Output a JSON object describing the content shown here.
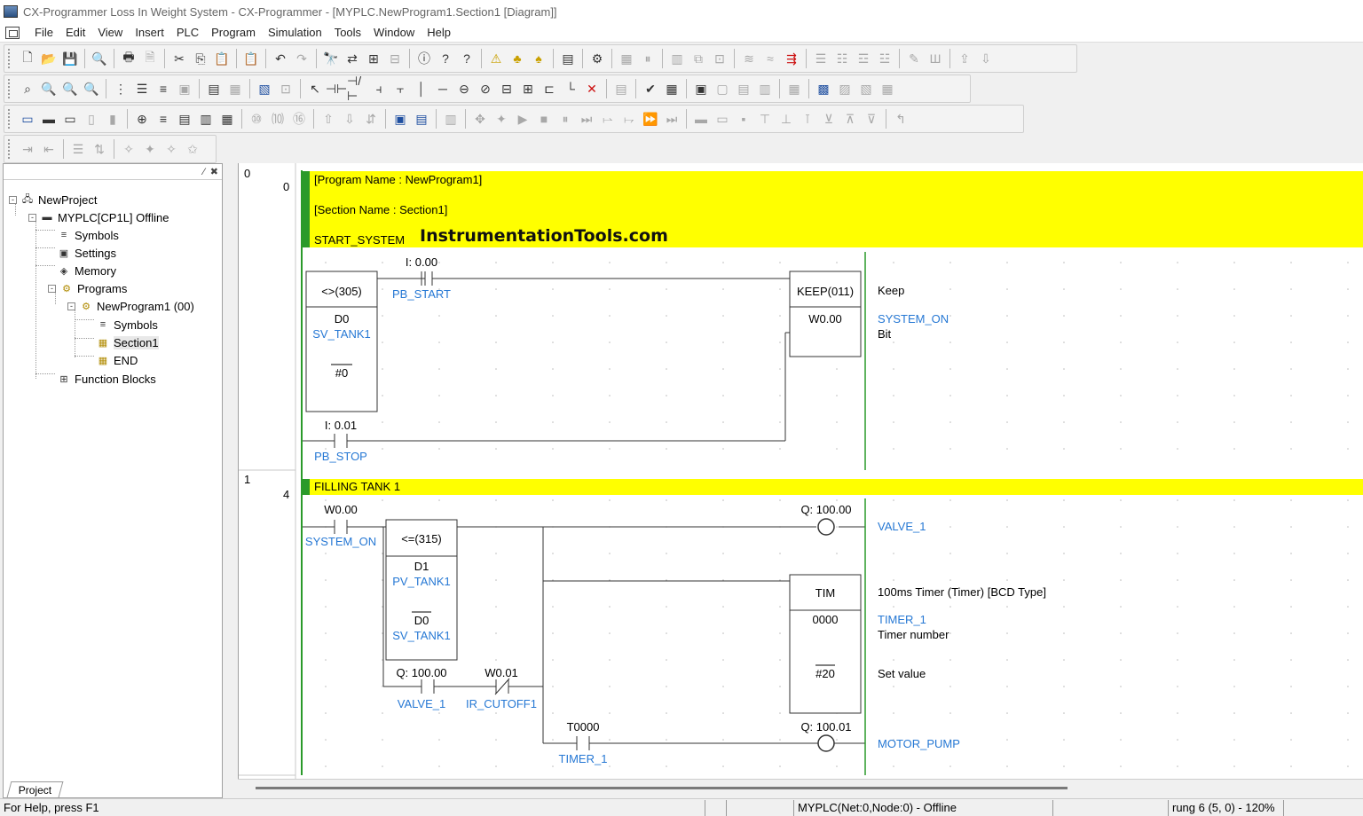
{
  "window": {
    "title": "CX-Programmer Loss In Weight System - CX-Programmer - [MYPLC.NewProgram1.Section1 [Diagram]]"
  },
  "menu": [
    "File",
    "Edit",
    "View",
    "Insert",
    "PLC",
    "Program",
    "Simulation",
    "Tools",
    "Window",
    "Help"
  ],
  "toolbars": {
    "row1": [
      "new-icon",
      "open-icon",
      "save-icon",
      "|",
      "print-preview-icon",
      "|",
      "print-icon",
      "page-preview-icon",
      "|",
      "cut-icon",
      "copy-icon",
      "paste-icon",
      "|",
      "plc-paste-icon",
      "|",
      "undo-icon",
      "redo-icon",
      "|",
      "find-icon",
      "replace-icon",
      "find-rung-icon",
      "find-address-icon",
      "|",
      "about-icon",
      "help-icon",
      "context-help-icon",
      "|",
      "error-log-icon",
      "monitor-icon",
      "cross-ref-icon",
      "|",
      "io-table-icon",
      "|",
      "plc-setup-icon",
      "|",
      "memory-icon",
      "pause-icon",
      "|",
      "properties-icon",
      "compare-icon",
      "address-icon",
      "|",
      "data-trace-icon",
      "time-chart-icon",
      "forced-icon",
      "|",
      "view-ladder-icon",
      "view-mnemonic-icon",
      "view-st-icon",
      "view-chart-icon",
      "|",
      "online-edit-icon",
      "cancel-icon",
      "|",
      "transfer-to-icon",
      "transfer-from-icon"
    ],
    "row2": [
      "zoom-in-icon",
      "zoom-fit-icon",
      "zoom-icon",
      "zoom-out-icon",
      "|",
      "grid-icon",
      "comments-icon",
      "rung-annotation-icon",
      "bookmark-icon",
      "|",
      "symbol-icon",
      "monitor-list-icon",
      "|",
      "symbol-table-icon",
      "address-icon",
      "|",
      "select-mode-icon",
      "contact-no-icon",
      "contact-nc-icon",
      "or-no-icon",
      "or-nc-icon",
      "vline-icon",
      "hline-icon",
      "coil-icon",
      "coil-nc-icon",
      "instruction-icon",
      "pin-icon",
      "bracket-icon",
      "line-connect-icon",
      "delete-line-icon",
      "|",
      "instruction-list-icon",
      "|",
      "program-check-icon",
      "io-comment-icon",
      "|",
      "online-icon",
      "offline-icon",
      "monitor-on-icon",
      "differential-icon",
      "|",
      "data-view-icon",
      "|",
      "program-mode-icon",
      "debug-mode-icon",
      "monitor-mode-icon",
      "run-mode-icon"
    ],
    "row3": [
      "window-project-icon",
      "window-output-icon",
      "window-watch-icon",
      "window-address-icon",
      "window-properties-icon",
      "|",
      "section-icon",
      "symbols-icon",
      "task-icon",
      "memory-card-icon",
      "io-map-icon",
      "|",
      "zoom-10-icon",
      "zoom-100-icon",
      "zoom-16-icon",
      "|",
      "upload-icon",
      "download-icon",
      "compare-plc-icon",
      "|",
      "simulator-start-icon",
      "simulator-stop-icon",
      "|",
      "simulator-debug-icon",
      "|",
      "step-icon",
      "break-icon",
      "play-icon",
      "stop-icon",
      "pause-icon",
      "step-into-icon",
      "step-over-icon",
      "step-out-icon",
      "continuous-icon",
      "scan-icon",
      "|",
      "breakpoint-icon",
      "break-all-icon",
      "break-clear-icon",
      "trace-icon",
      "trigger-icon",
      "condition-icon",
      "data-set-icon",
      "data-reset-icon",
      "force-icon",
      "|",
      "return-icon"
    ],
    "row4": [
      "indent-icon",
      "outdent-icon",
      "|",
      "list-icon",
      "sort-icon",
      "|",
      "mark-icon",
      "mark-next-icon",
      "mark-prev-icon",
      "mark-clear-icon"
    ]
  },
  "project_tree": {
    "items": [
      {
        "label": "NewProject",
        "icon": "project-icon",
        "expander": "-"
      },
      {
        "label": "MYPLC[CP1L] Offline",
        "icon": "plc-icon",
        "expander": "-"
      },
      {
        "label": "Symbols",
        "icon": "symbols-icon"
      },
      {
        "label": "Settings",
        "icon": "settings-icon"
      },
      {
        "label": "Memory",
        "icon": "memory-icon"
      },
      {
        "label": "Programs",
        "icon": "programs-icon",
        "expander": "-"
      },
      {
        "label": "NewProgram1 (00)",
        "icon": "program-icon",
        "expander": "-"
      },
      {
        "label": "Symbols",
        "icon": "symbols-icon"
      },
      {
        "label": "Section1",
        "icon": "section-icon",
        "selected": true
      },
      {
        "label": "END",
        "icon": "section-icon"
      },
      {
        "label": "Function Blocks",
        "icon": "function-blocks-icon"
      }
    ],
    "tab": "Project"
  },
  "ladder": {
    "rungs": [
      {
        "rung_number": "0",
        "step": "0",
        "comment_lines": [
          "[Program Name : NewProgram1]",
          "[Section Name : Section1]",
          "START_SYSTEM"
        ],
        "watermark": "InstrumentationTools.com",
        "compare_block": {
          "instruction": "<>(305)",
          "op1_address": "D0",
          "op1_symbol": "SV_TANK1",
          "op2": "#0"
        },
        "contact_start": {
          "address": "I: 0.00",
          "symbol": "PB_START"
        },
        "contact_stop": {
          "address": "I: 0.01",
          "symbol": "PB_STOP"
        },
        "keep_block": {
          "instruction": "KEEP(011)",
          "operand": "W0.00",
          "comment_type": "Keep",
          "comment_symbol": "SYSTEM_ON",
          "comment_kind": "Bit"
        }
      },
      {
        "rung_number": "1",
        "step": "4",
        "comment_lines": [
          "FILLING TANK 1"
        ],
        "contact_system_on": {
          "address": "W0.00",
          "symbol": "SYSTEM_ON"
        },
        "compare_block": {
          "instruction": "<=(315)",
          "op1_address": "D1",
          "op1_symbol": "PV_TANK1",
          "op2_address": "D0",
          "op2_symbol": "SV_TANK1"
        },
        "contact_valve": {
          "address": "Q: 100.00",
          "symbol": "VALVE_1"
        },
        "contact_cutoff": {
          "address": "W0.01",
          "symbol": "IR_CUTOFF1"
        },
        "coil_valve": {
          "address": "Q: 100.00",
          "symbol": "VALVE_1"
        },
        "timer_block": {
          "instruction": "TIM",
          "number": "0000",
          "set_value": "#20",
          "comment_type": "100ms Timer (Timer) [BCD Type]",
          "comment_symbol": "TIMER_1",
          "comment_number": "Timer number",
          "comment_set": "Set value"
        },
        "contact_timer": {
          "address": "T0000",
          "symbol": "TIMER_1"
        },
        "coil_pump": {
          "address": "Q: 100.01",
          "symbol": "MOTOR_PUMP"
        }
      }
    ]
  },
  "status": {
    "help": "For Help, press F1",
    "plc": "MYPLC(Net:0,Node:0) - Offline",
    "position": "rung 6 (5, 0)  - 120%"
  }
}
